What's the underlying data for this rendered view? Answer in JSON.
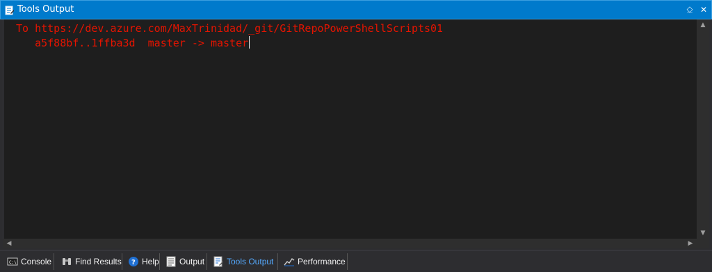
{
  "window": {
    "title": "Tools Output",
    "pin_glyph": "⎐",
    "close_glyph": "✕"
  },
  "output": {
    "lines": [
      "To https://dev.azure.com/MaxTrinidad/_git/GitRepoPowerShellScripts01",
      "   a5f88bf..1ffba3d  master -> master"
    ],
    "text_color": "#e51400"
  },
  "scrollbars": {
    "up_glyph": "▲",
    "down_glyph": "▼",
    "left_glyph": "◀",
    "right_glyph": "▶"
  },
  "tabs": [
    {
      "label": "Console",
      "icon": "console-icon"
    },
    {
      "label": "Find Results",
      "icon": "binoculars-icon"
    },
    {
      "label": "Help",
      "icon": "help-icon"
    },
    {
      "label": "Output",
      "icon": "output-icon"
    },
    {
      "label": "Tools Output",
      "icon": "tools-output-icon",
      "active": true
    },
    {
      "label": "Performance",
      "icon": "performance-icon"
    }
  ],
  "colors": {
    "titlebar": "#007acc",
    "active_tab": "#55aaff",
    "editor_bg": "#1e1e1e"
  }
}
